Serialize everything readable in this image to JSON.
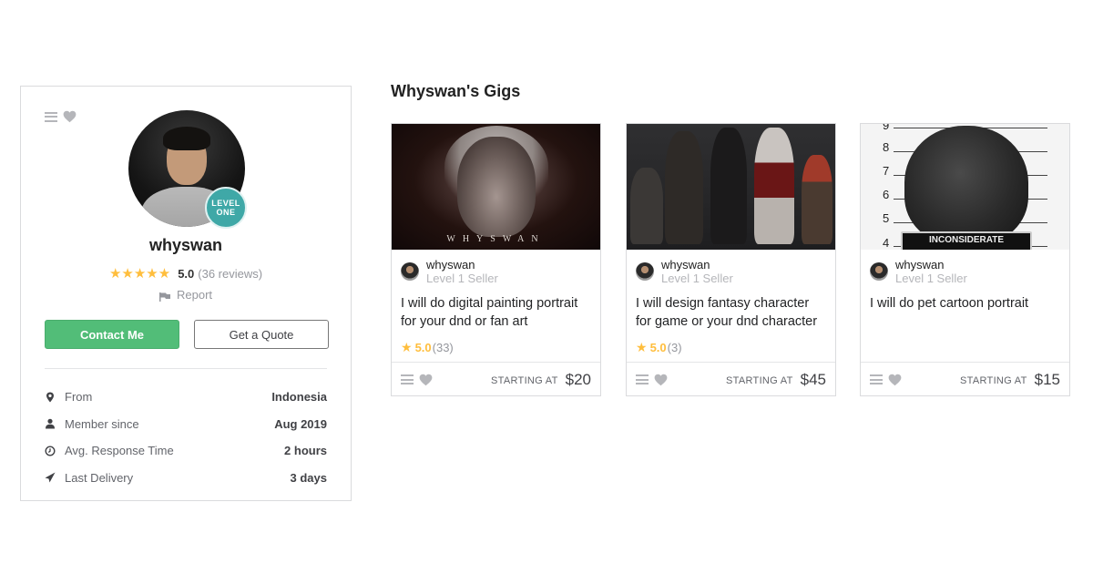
{
  "profile": {
    "username": "whyswan",
    "level_badge": "LEVEL ONE",
    "stars": "★★★★★",
    "rating": "5.0",
    "reviews": "(36 reviews)",
    "report_label": "Report",
    "contact_label": "Contact Me",
    "quote_label": "Get a Quote",
    "stats": [
      {
        "icon": "location-pin-icon",
        "label": "From",
        "value": "Indonesia"
      },
      {
        "icon": "user-icon",
        "label": "Member since",
        "value": "Aug 2019"
      },
      {
        "icon": "clock-icon",
        "label": "Avg. Response Time",
        "value": "2 hours"
      },
      {
        "icon": "paper-plane-icon",
        "label": "Last Delivery",
        "value": "3 days"
      }
    ]
  },
  "gigs_section": {
    "title": "Whyswan's Gigs",
    "starting_label": "STARTING AT",
    "gigs": [
      {
        "image_watermark": "WHYSWAN",
        "seller": "whyswan",
        "seller_level": "Level 1 Seller",
        "title": "I will do digital painting portrait for your dnd or fan art",
        "rating": "5.0",
        "rating_count": "(33)",
        "price": "$20"
      },
      {
        "seller": "whyswan",
        "seller_level": "Level 1 Seller",
        "title": "I will design fantasy character for game or your dnd character",
        "rating": "5.0",
        "rating_count": "(3)",
        "price": "$45"
      },
      {
        "image_sign_text": "INCONSIDERATE",
        "image_numbers": [
          "9",
          "8",
          "7",
          "6",
          "5",
          "4"
        ],
        "seller": "whyswan",
        "seller_level": "Level 1 Seller",
        "title": "I will do pet cartoon portrait",
        "price": "$15"
      }
    ]
  },
  "colors": {
    "accent_green": "#52bd78",
    "level_teal": "#3fa8a7",
    "star_yellow": "#ffbe3d"
  }
}
